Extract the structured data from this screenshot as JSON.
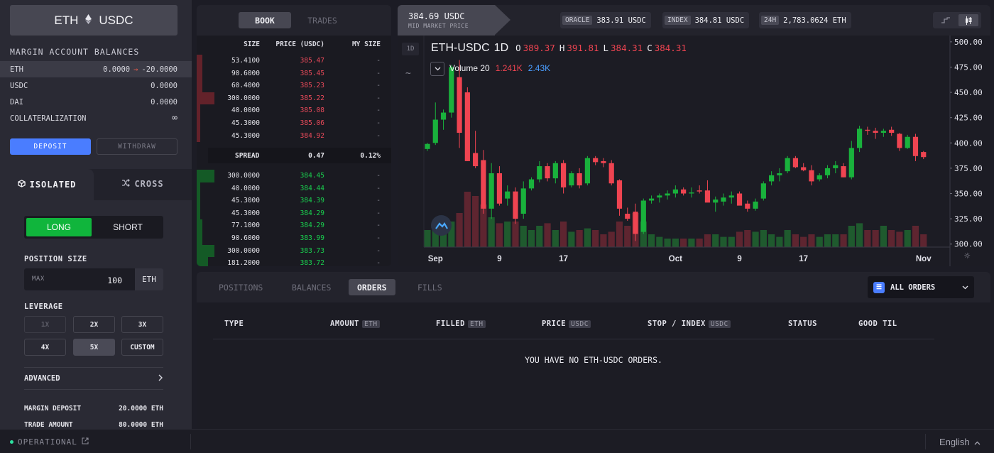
{
  "market": {
    "base": "ETH",
    "quote": "USDC",
    "sep_icon": "ethereum-diamond-icon"
  },
  "balances": {
    "title": "MARGIN ACCOUNT BALANCES",
    "rows": [
      {
        "label": "ETH",
        "value": "0.0000",
        "arrow": "→",
        "after": "-20.0000"
      },
      {
        "label": "USDC",
        "value": "0.0000"
      },
      {
        "label": "DAI",
        "value": "0.0000"
      },
      {
        "label": "COLLATERALIZATION",
        "value": "∞"
      }
    ],
    "deposit": "DEPOSIT",
    "withdraw": "WITHDRAW"
  },
  "mode_tabs": {
    "isolated": "ISOLATED",
    "cross": "CROSS"
  },
  "trade": {
    "long": "LONG",
    "short": "SHORT",
    "position_size_label": "POSITION SIZE",
    "max": "MAX",
    "size_value": "100",
    "size_unit": "ETH",
    "leverage_label": "LEVERAGE",
    "leverage": [
      "1X",
      "2X",
      "3X",
      "4X",
      "5X",
      "CUSTOM"
    ],
    "advanced": "ADVANCED",
    "summary": [
      {
        "label": "MARGIN DEPOSIT",
        "value": "20.0000 ETH"
      },
      {
        "label": "TRADE AMOUNT",
        "value": "80.0000 ETH"
      }
    ]
  },
  "orderbook": {
    "tabs": [
      "BOOK",
      "TRADES"
    ],
    "headers": {
      "size": "SIZE",
      "price": "PRICE (USDC)",
      "mine": "MY SIZE"
    },
    "asks": [
      {
        "size": "53.4100",
        "price": "385.47",
        "mine": "-",
        "depth": 0.03
      },
      {
        "size": "90.6000",
        "price": "385.45",
        "mine": "-",
        "depth": 0.03
      },
      {
        "size": "60.4000",
        "price": "385.23",
        "mine": "-",
        "depth": 0.03
      },
      {
        "size": "300.0000",
        "price": "385.22",
        "mine": "-",
        "depth": 0.09
      },
      {
        "size": "40.0000",
        "price": "385.08",
        "mine": "-",
        "depth": 0.02
      },
      {
        "size": "45.3000",
        "price": "385.06",
        "mine": "-",
        "depth": 0.02
      },
      {
        "size": "45.3000",
        "price": "384.92",
        "mine": "-",
        "depth": 0.02
      }
    ],
    "spread": {
      "label": "SPREAD",
      "value": "0.47",
      "pct": "0.12%"
    },
    "bids": [
      {
        "size": "300.0000",
        "price": "384.45",
        "mine": "-",
        "depth": 0.09
      },
      {
        "size": "40.0000",
        "price": "384.44",
        "mine": "-",
        "depth": 0.02
      },
      {
        "size": "45.3000",
        "price": "384.39",
        "mine": "-",
        "depth": 0.02
      },
      {
        "size": "45.3000",
        "price": "384.29",
        "mine": "-",
        "depth": 0.02
      },
      {
        "size": "77.1000",
        "price": "384.29",
        "mine": "-",
        "depth": 0.03
      },
      {
        "size": "90.6000",
        "price": "383.99",
        "mine": "-",
        "depth": 0.03
      },
      {
        "size": "300.0000",
        "price": "383.73",
        "mine": "-",
        "depth": 0.09
      },
      {
        "size": "181.2000",
        "price": "383.72",
        "mine": "-",
        "depth": 0.06
      }
    ]
  },
  "header": {
    "mid_price": "384.69 USDC",
    "mid_label": "MID MARKET PRICE",
    "oracle_label": "ORACLE",
    "oracle": "383.91 USDC",
    "index_label": "INDEX",
    "index": "384.81 USDC",
    "vol_label": "24H",
    "vol": "2,783.0624 ETH"
  },
  "chart_data": {
    "type": "candlestick",
    "symbol": "ETH-USDC",
    "interval": "1D",
    "ohlc": {
      "o_label": "O",
      "o": "389.37",
      "h_label": "H",
      "h": "391.81",
      "l_label": "L",
      "l": "384.31",
      "c_label": "C",
      "c": "384.31"
    },
    "volume": {
      "label": "Volume 20",
      "a": "1.241K",
      "b": "2.43K"
    },
    "y_ticks": [
      "500.00",
      "475.00",
      "450.00",
      "425.00",
      "400.00",
      "375.00",
      "350.00",
      "325.00",
      "300.00"
    ],
    "ylim": [
      297,
      502
    ],
    "x_ticks": [
      {
        "label": "Sep",
        "i": 1
      },
      {
        "label": "9",
        "i": 9
      },
      {
        "label": "17",
        "i": 17
      },
      {
        "label": "Oct",
        "i": 31
      },
      {
        "label": "9",
        "i": 39
      },
      {
        "label": "17",
        "i": 47
      },
      {
        "label": "Nov",
        "i": 62
      }
    ],
    "candles": [
      [
        394,
        400,
        392,
        399,
        0.2
      ],
      [
        400,
        440,
        398,
        423,
        0.25
      ],
      [
        423,
        433,
        413,
        430,
        0.2
      ],
      [
        430,
        477,
        425,
        475,
        0.3
      ],
      [
        465,
        482,
        395,
        410,
        0.4
      ],
      [
        450,
        455,
        382,
        382,
        0.65
      ],
      [
        390,
        412,
        375,
        377,
        0.6
      ],
      [
        383,
        393,
        330,
        335,
        0.5
      ],
      [
        335,
        380,
        325,
        370,
        0.35
      ],
      [
        370,
        377,
        338,
        340,
        0.28
      ],
      [
        345,
        358,
        338,
        352,
        0.3
      ],
      [
        352,
        356,
        320,
        325,
        0.3
      ],
      [
        330,
        362,
        325,
        355,
        0.25
      ],
      [
        355,
        366,
        353,
        364,
        0.2
      ],
      [
        364,
        382,
        361,
        377,
        0.25
      ],
      [
        377,
        380,
        362,
        365,
        0.28
      ],
      [
        365,
        382,
        360,
        380,
        0.2
      ],
      [
        380,
        383,
        350,
        356,
        0.3
      ],
      [
        358,
        372,
        356,
        370,
        0.18
      ],
      [
        370,
        375,
        355,
        358,
        0.2
      ],
      [
        360,
        387,
        358,
        385,
        0.22
      ],
      [
        385,
        387,
        378,
        381,
        0.2
      ],
      [
        382,
        385,
        376,
        380,
        0.15
      ],
      [
        380,
        383,
        358,
        360,
        0.18
      ],
      [
        363,
        364,
        328,
        335,
        0.3
      ],
      [
        330,
        336,
        323,
        325,
        0.25
      ],
      [
        332,
        340,
        303,
        310,
        0.4
      ],
      [
        312,
        345,
        310,
        343,
        0.3
      ],
      [
        343,
        348,
        340,
        345,
        0.15
      ],
      [
        346,
        350,
        341,
        348,
        0.12
      ],
      [
        348,
        353,
        344,
        350,
        0.1
      ],
      [
        350,
        358,
        346,
        354,
        0.1
      ],
      [
        354,
        356,
        348,
        350,
        0.1
      ],
      [
        350,
        356,
        346,
        351,
        0.1
      ],
      [
        353,
        358,
        350,
        352,
        0.1
      ],
      [
        353,
        363,
        342,
        341,
        0.15
      ],
      [
        341,
        347,
        332,
        344,
        0.15
      ],
      [
        342,
        350,
        338,
        346,
        0.12
      ],
      [
        346,
        352,
        340,
        348,
        0.12
      ],
      [
        350,
        352,
        340,
        338,
        0.18
      ],
      [
        340,
        343,
        332,
        335,
        0.2
      ],
      [
        335,
        345,
        333,
        342,
        0.18
      ],
      [
        345,
        362,
        343,
        360,
        0.2
      ],
      [
        362,
        372,
        358,
        368,
        0.15
      ],
      [
        368,
        375,
        362,
        370,
        0.12
      ],
      [
        372,
        387,
        370,
        385,
        0.2
      ],
      [
        385,
        387,
        375,
        376,
        0.15
      ],
      [
        376,
        380,
        372,
        373,
        0.12
      ],
      [
        373,
        378,
        358,
        362,
        0.15
      ],
      [
        364,
        370,
        362,
        368,
        0.12
      ],
      [
        368,
        378,
        365,
        375,
        0.15
      ],
      [
        375,
        382,
        370,
        378,
        0.15
      ],
      [
        377,
        380,
        366,
        366,
        0.15
      ],
      [
        366,
        402,
        364,
        395,
        0.25
      ],
      [
        395,
        417,
        391,
        414,
        0.28
      ],
      [
        413,
        416,
        408,
        412,
        0.2
      ],
      [
        412,
        415,
        404,
        410,
        0.2
      ],
      [
        410,
        414,
        406,
        412,
        0.25
      ],
      [
        413,
        416,
        407,
        410,
        0.2
      ],
      [
        409,
        410,
        392,
        395,
        0.18
      ],
      [
        395,
        408,
        394,
        406,
        0.2
      ],
      [
        406,
        409,
        382,
        387,
        0.25
      ],
      [
        391,
        392,
        384,
        386,
        0.15
      ]
    ]
  },
  "orders": {
    "tabs": [
      "POSITIONS",
      "BALANCES",
      "ORDERS",
      "FILLS"
    ],
    "filter": "ALL ORDERS",
    "columns": [
      {
        "label": "TYPE"
      },
      {
        "label": "AMOUNT",
        "unit": "ETH"
      },
      {
        "label": "FILLED",
        "unit": "ETH"
      },
      {
        "label": "PRICE",
        "unit": "USDC"
      },
      {
        "label": "STOP / INDEX",
        "unit": "USDC"
      },
      {
        "label": "STATUS"
      },
      {
        "label": "GOOD TIL"
      }
    ],
    "empty": "YOU HAVE NO ETH-USDC ORDERS."
  },
  "footer": {
    "status": "OPERATIONAL",
    "language": "English"
  },
  "colors": {
    "up": "#19b13c",
    "down": "#ef4451",
    "accent": "#4a7dff"
  }
}
